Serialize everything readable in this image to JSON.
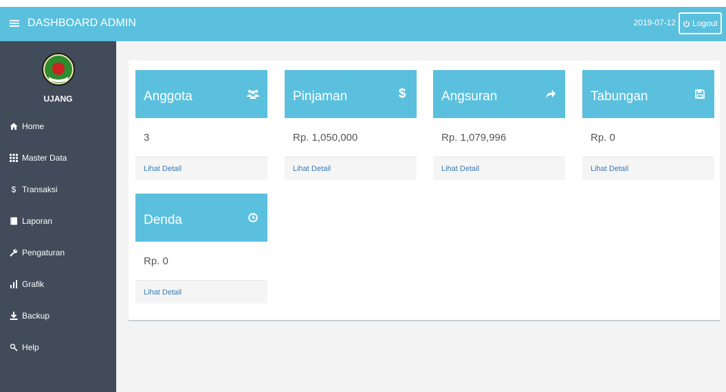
{
  "header": {
    "title": "DASHBOARD ADMIN",
    "date": "2019-07-12",
    "logout_label": "Logout"
  },
  "sidebar": {
    "user": "UJANG",
    "items": [
      {
        "label": "Home",
        "icon": "home-icon"
      },
      {
        "label": "Master Data",
        "icon": "grid-icon"
      },
      {
        "label": "Transaksi",
        "icon": "dollar-icon"
      },
      {
        "label": "Laporan",
        "icon": "book-icon"
      },
      {
        "label": "Pengaturan",
        "icon": "wrench-icon"
      },
      {
        "label": "Grafik",
        "icon": "bar-chart-icon"
      },
      {
        "label": "Backup",
        "icon": "download-icon"
      },
      {
        "label": "Help",
        "icon": "help-icon"
      }
    ]
  },
  "cards": [
    {
      "title": "Anggota",
      "value": "3",
      "link": "Lihat Detail",
      "icon": "users-icon"
    },
    {
      "title": "Pinjaman",
      "value": "Rp. 1,050,000",
      "link": "Lihat Detail",
      "icon": "dollar-icon"
    },
    {
      "title": "Angsuran",
      "value": "Rp. 1,079,996",
      "link": "Lihat Detail",
      "icon": "share-arrow-icon"
    },
    {
      "title": "Tabungan",
      "value": "Rp. 0",
      "link": "Lihat Detail",
      "icon": "save-icon"
    },
    {
      "title": "Denda",
      "value": "Rp. 0",
      "link": "Lihat Detail",
      "icon": "clock-icon"
    }
  ],
  "colors": {
    "accent": "#5bc0de",
    "sidebar": "#414b5a",
    "link": "#337ab7"
  }
}
